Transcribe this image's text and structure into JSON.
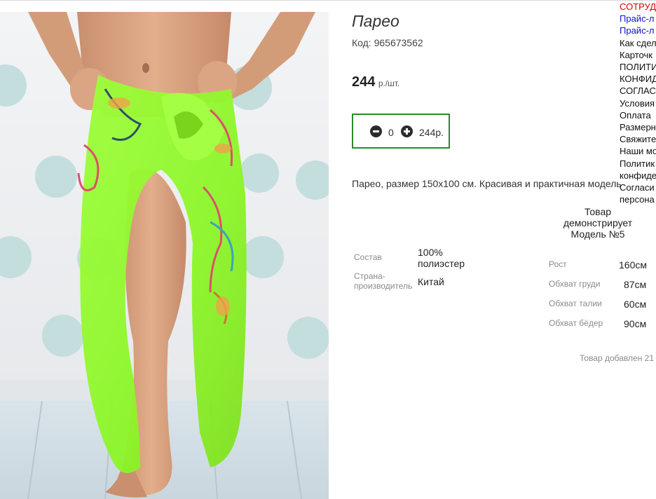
{
  "product": {
    "title": "Парео",
    "code_label": "Код: 965673562",
    "price": "244",
    "price_unit": "р./шт.",
    "quantity": "0",
    "sum": "244р.",
    "description": "Парео, размер 150х100 см. Красивая и практичная модель",
    "added": "Товар добавлен 21"
  },
  "attributes": [
    {
      "label": "Состав",
      "value": "100% полиэстер"
    },
    {
      "label": "Страна-производитель",
      "value": "Китай"
    }
  ],
  "model": {
    "heading": "Товар демонстрирует Модель №5",
    "measures": [
      {
        "label": "Рост",
        "value": "160см"
      },
      {
        "label": "Обхват груди",
        "value": "87см"
      },
      {
        "label": "Обхват талии",
        "value": "60см"
      },
      {
        "label": "Обхват бёдер",
        "value": "90см"
      }
    ]
  },
  "links": [
    {
      "label": "СОТРУД",
      "color": "#e00000"
    },
    {
      "label": "Прайс-л",
      "color": "#1010d0"
    },
    {
      "label": "Прайс-л",
      "color": "#1010d0"
    },
    {
      "label": "Как сдел",
      "color": "#111111"
    },
    {
      "label": "Карточк",
      "color": "#111111"
    },
    {
      "label": "ПОЛИТИ",
      "color": "#111111"
    },
    {
      "label": "КОНФИД",
      "color": "#111111"
    },
    {
      "label": "СОГЛАС",
      "color": "#111111"
    },
    {
      "label": "Условия",
      "color": "#111111"
    },
    {
      "label": "Оплата",
      "color": "#111111"
    },
    {
      "label": "Размерн",
      "color": "#111111"
    },
    {
      "label": "Свяжите",
      "color": "#111111"
    },
    {
      "label": "Наши мо",
      "color": "#111111"
    },
    {
      "label": "Политик",
      "color": "#111111"
    },
    {
      "label": "конфиде",
      "color": "#111111"
    },
    {
      "label": "Согласи",
      "color": "#111111"
    },
    {
      "label": "персона",
      "color": "#111111"
    }
  ],
  "icons": {
    "minus": "minus-circle-icon",
    "plus": "plus-circle-icon"
  },
  "colors": {
    "qty_border": "#2a8a2a",
    "pareo_green": "#8cff2a"
  }
}
